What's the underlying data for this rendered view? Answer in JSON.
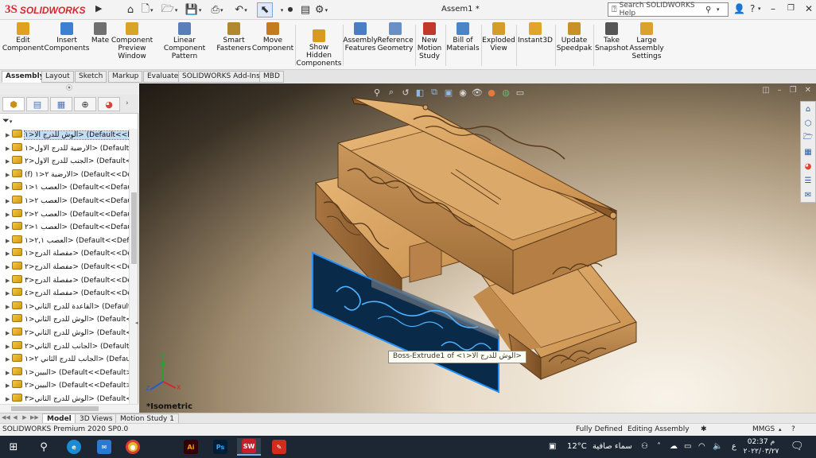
{
  "app": {
    "logo_ds": "3S",
    "logo_text": "SOLIDWORKS",
    "doc_title": "Assem1 *",
    "search_placeholder": "Search SOLIDWORKS Help"
  },
  "commands": [
    {
      "id": "edit-component",
      "label": "Edit Component",
      "color": "#e0a020"
    },
    {
      "id": "insert-components",
      "label": "Insert Components",
      "color": "#3d7fd1"
    },
    {
      "id": "mate",
      "label": "Mate",
      "color": "#707070"
    },
    {
      "id": "component-preview",
      "label": "Component Preview Window",
      "color": "#d9a32a"
    },
    {
      "id": "linear-pattern",
      "label": "Linear Component Pattern",
      "color": "#5a7fb8"
    },
    {
      "id": "smart-fasteners",
      "label": "Smart Fasteners",
      "color": "#b0892e"
    },
    {
      "id": "move-component",
      "label": "Move Component",
      "color": "#c47b20"
    },
    {
      "id": "show-hidden",
      "label": "Show Hidden Components",
      "color": "#d99b1f"
    },
    {
      "id": "assembly-features",
      "label": "Assembly Features",
      "color": "#4a7ec4"
    },
    {
      "id": "reference-geometry",
      "label": "Reference Geometry",
      "color": "#6a8fc4"
    },
    {
      "id": "new-motion-study",
      "label": "New Motion Study",
      "color": "#c0392b"
    },
    {
      "id": "bill-of-materials",
      "label": "Bill of Materials",
      "color": "#4a86c7"
    },
    {
      "id": "exploded-view",
      "label": "Exploded View",
      "color": "#d49d2a"
    },
    {
      "id": "instant3d",
      "label": "Instant3D",
      "color": "#e0a62a"
    },
    {
      "id": "update-speedpak",
      "label": "Update Speedpak",
      "color": "#c79125"
    },
    {
      "id": "take-snapshot",
      "label": "Take Snapshot",
      "color": "#555555"
    },
    {
      "id": "large-assembly-settings",
      "label": "Large Assembly Settings",
      "color": "#d9a22e"
    }
  ],
  "tabs": [
    "Assembly",
    "Layout",
    "Sketch",
    "Markup",
    "Evaluate",
    "SOLIDWORKS Add-Ins",
    "MBD"
  ],
  "active_tab": "Assembly",
  "tree": [
    {
      "label": "الوش للدرج الا<١> (Default<<De",
      "selected": true
    },
    {
      "label": "الارضية للدرج الاول<١> (Default",
      "selected": false
    },
    {
      "label": "الجنب للدرج الاول<٢> (Default<",
      "selected": false
    },
    {
      "label": "(f) الارضية ٢<١> (Default<<Def",
      "selected": false
    },
    {
      "label": "العصب ١<١> (Default<<Default",
      "selected": false
    },
    {
      "label": "العصب ٢<١> (Default<<Defaul",
      "selected": false
    },
    {
      "label": "العصب ٢<٢> (Default<<Defau",
      "selected": false
    },
    {
      "label": "العصب ١<٢> (Default<<Defaul",
      "selected": false
    },
    {
      "label": "العصب ٢,١<١> (Default<<Defau",
      "selected": false
    },
    {
      "label": "مفصلة الدرج<١> (Default<<Def",
      "selected": false
    },
    {
      "label": "مفصلة الدرج<٢> (Default<<De",
      "selected": false
    },
    {
      "label": "مفصلة الدرج<٣> (Default<<De",
      "selected": false
    },
    {
      "label": "مفصلة الدرج<٤> (Default<<De",
      "selected": false
    },
    {
      "label": "القاعدة للدرج الثاني<١> (Default",
      "selected": false
    },
    {
      "label": "الوش للدرج الثاني<١> (Default<",
      "selected": false
    },
    {
      "label": "الوش للدرج الثاني<٢> (Default<",
      "selected": false
    },
    {
      "label": "الجانب للدرج الثاني<٢> (Default",
      "selected": false
    },
    {
      "label": "الجانب للدرج الثاني ٢<١> (Defaul",
      "selected": false
    },
    {
      "label": "البيبن<١> (Default<<Default>_[",
      "selected": false
    },
    {
      "label": "البيبن<٢> (Default<<Default>_",
      "selected": false
    },
    {
      "label": "الوش للدرج الثاني<٣> (Default<",
      "selected": false
    }
  ],
  "viewport": {
    "view_name": "*Isometric",
    "tooltip": "Boss-Extrude1 of <الوش للدرج الا<١>"
  },
  "bottom_tabs": [
    "Model",
    "3D Views",
    "Motion Study 1"
  ],
  "active_bottom_tab": "Model",
  "status": {
    "product": "SOLIDWORKS Premium 2020 SP0.0",
    "defined": "Fully Defined",
    "mode": "Editing Assembly",
    "units": "MMGS"
  },
  "taskbar": {
    "weather": "12°C",
    "weather_text": "سماء صافية",
    "lang": "ع",
    "time": "02:37 م",
    "date": "٢٠٢٢/٠٣/٢٧"
  },
  "colors": {
    "wood_light": "#d9a96a",
    "wood_dark": "#8a5a2c",
    "selection": "#1e90ff"
  }
}
